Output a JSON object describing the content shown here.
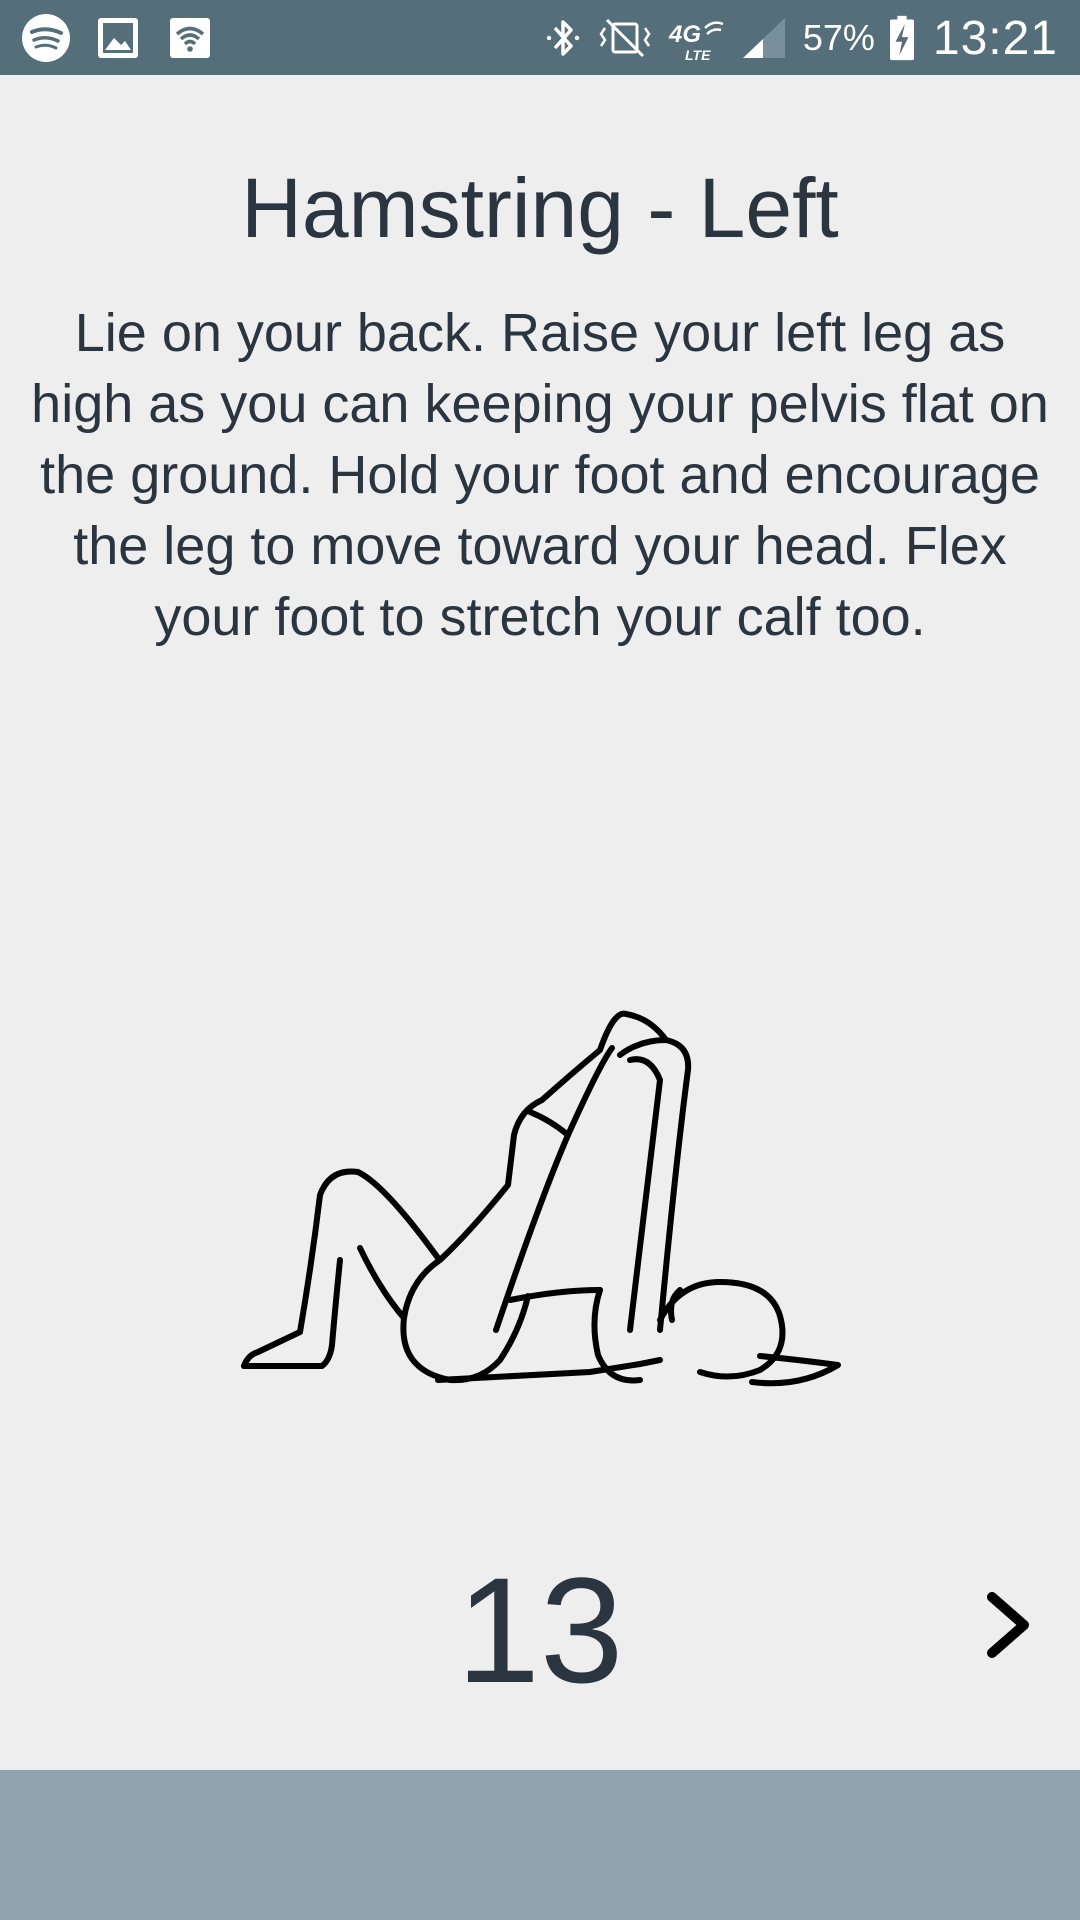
{
  "status_bar": {
    "icons_left": [
      "spotify-icon",
      "gallery-icon",
      "wifi-status-icon"
    ],
    "icons_right": [
      "bluetooth-icon",
      "vibrate-icon",
      "4g-lte-icon",
      "signal-icon"
    ],
    "battery_level": "57%",
    "time": "13:21"
  },
  "exercise": {
    "title": "Hamstring - Left",
    "description": "Lie on your back. Raise your left leg as high as you can keeping your pelvis flat on the ground. Hold your foot and encourage the leg to move toward your head. Flex your foot to stretch your calf too.",
    "illustration_icon": "hamstring-stretch-figure-icon"
  },
  "timer": {
    "count": "13"
  },
  "navigation": {
    "next_icon": "chevron-right-icon"
  },
  "colors": {
    "status_bar": "#546e7a",
    "background": "#eeeeee",
    "text": "#2b3540",
    "bottom_bar": "#90a4ae"
  }
}
